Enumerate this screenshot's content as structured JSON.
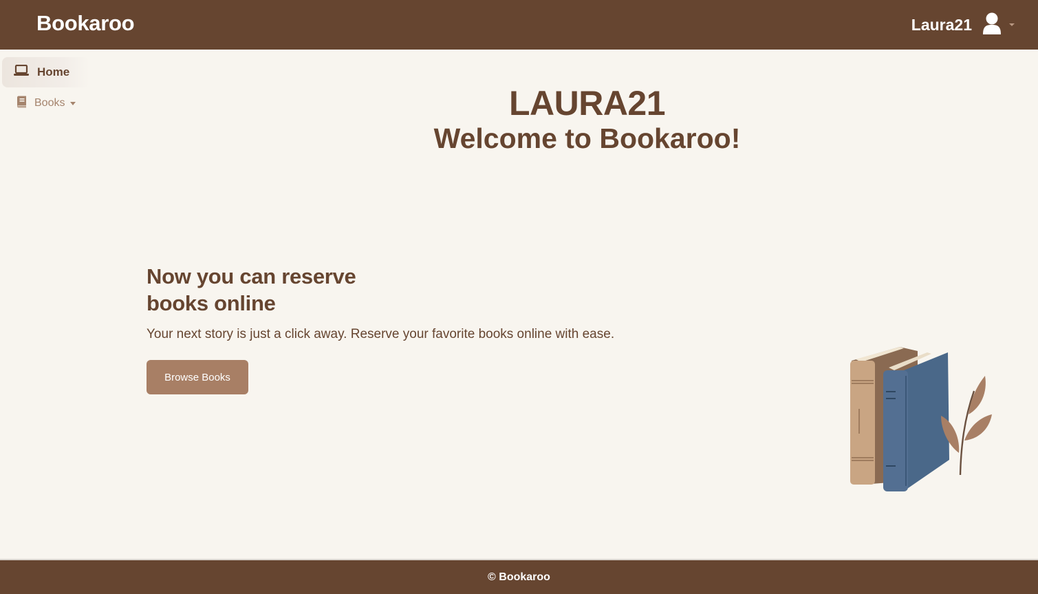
{
  "header": {
    "brand": "Bookaroo",
    "username": "Laura21"
  },
  "sidebar": {
    "items": [
      {
        "label": "Home",
        "icon": "laptop-icon",
        "active": true
      },
      {
        "label": "Books",
        "icon": "book-icon",
        "active": false
      }
    ]
  },
  "hero": {
    "username_upper": "LAURA21",
    "welcome": "Welcome to Bookaroo!"
  },
  "promo": {
    "heading": "Now you can reserve books online",
    "text": "Your next story is just a click away. Reserve your favorite books online with ease.",
    "button_label": "Browse Books"
  },
  "footer": {
    "text": "© Bookaroo"
  },
  "colors": {
    "brand_brown": "#664530",
    "background": "#f8f5ef",
    "button": "#a87f65",
    "book_blue": "#4a6889",
    "book_tan": "#c9a583"
  }
}
